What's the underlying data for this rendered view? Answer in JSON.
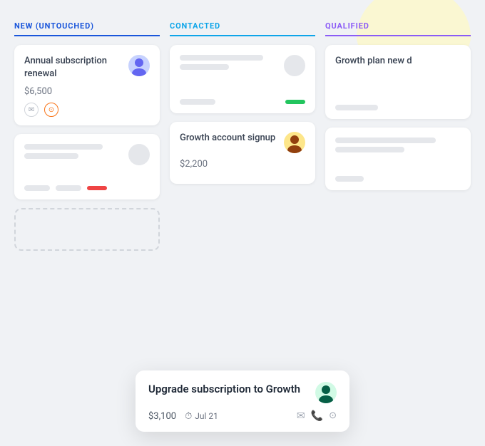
{
  "board": {
    "columns": [
      {
        "id": "new",
        "label": "NEW (UNTOUCHED)",
        "color": "#1a56db"
      },
      {
        "id": "contacted",
        "label": "CONTACTED",
        "color": "#0ea5e9"
      },
      {
        "id": "qualified",
        "label": "QUALIFIED",
        "color": "#8b5cf6"
      }
    ],
    "cards": {
      "new": [
        {
          "id": "card-new-1",
          "title": "Annual subscription renewal",
          "amount": "$6,500",
          "hasAvatar": true,
          "avatarClass": "avatar-1",
          "footerIcons": [
            "email",
            "timer"
          ],
          "statusColor": null
        },
        {
          "id": "card-new-2",
          "title": null,
          "amount": null,
          "hasAvatar": true,
          "avatarClass": "avatar-placeholder",
          "footerIcons": [],
          "statusColor": "red"
        }
      ],
      "contacted": [
        {
          "id": "card-contacted-1",
          "title": null,
          "amount": null,
          "hasAvatar": true,
          "avatarClass": "avatar-placeholder",
          "footerIcons": [],
          "statusColor": "green"
        },
        {
          "id": "card-contacted-2",
          "title": "Growth account signup",
          "amount": "$2,200",
          "hasAvatar": true,
          "avatarClass": "avatar-2",
          "footerIcons": [],
          "statusColor": null
        }
      ],
      "qualified": [
        {
          "id": "card-qualified-1",
          "title": "Growth plan new d",
          "amount": null,
          "hasAvatar": false,
          "avatarClass": null,
          "footerIcons": [],
          "statusColor": null,
          "clipped": true
        },
        {
          "id": "card-qualified-2",
          "title": null,
          "amount": null,
          "hasAvatar": false,
          "statusColor": null
        }
      ]
    },
    "floating_card": {
      "title": "Upgrade subscription to Growth",
      "amount": "$3,100",
      "date": "Jul 21",
      "avatarClass": "avatar-3",
      "icons": [
        "email",
        "phone",
        "timer"
      ]
    }
  }
}
